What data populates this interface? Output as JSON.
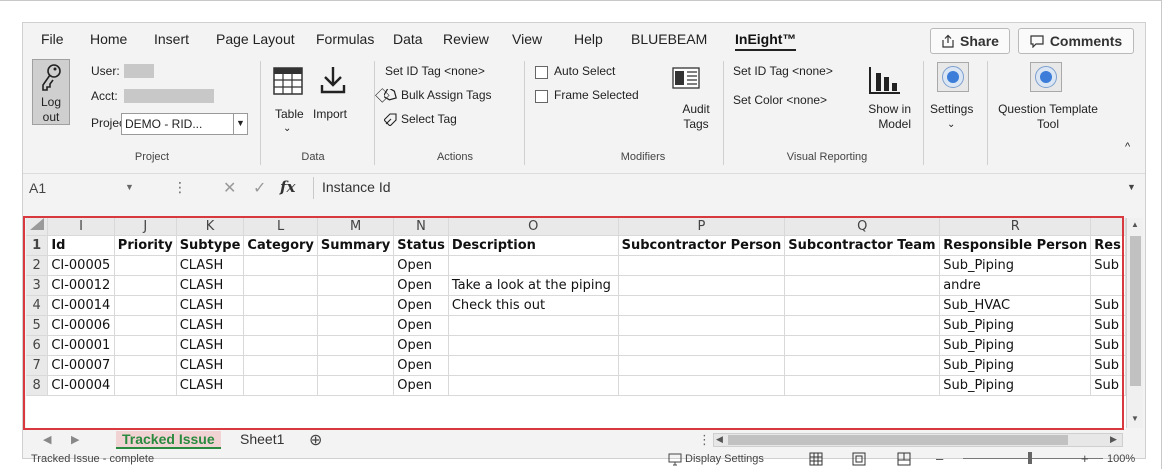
{
  "tabs": [
    "File",
    "Home",
    "Insert",
    "Page Layout",
    "Formulas",
    "Data",
    "Review",
    "View",
    "Help",
    "BLUEBEAM",
    "InEight™"
  ],
  "share_label": "Share",
  "comments_label": "Comments",
  "ribbon": {
    "project_group": {
      "logout_label": "Log out",
      "user_label": "User:",
      "acct_label": "Acct:",
      "project_label": "Project:",
      "project_value": "DEMO - RID...",
      "group_label": "Project"
    },
    "data_group": {
      "table_label": "Table",
      "import_label": "Import",
      "group_label": "Data"
    },
    "actions_group": {
      "set_id_tag": "Set ID Tag <none>",
      "bulk_assign": "Bulk Assign Tags",
      "select_tag": "Select Tag",
      "group_label": "Actions"
    },
    "modifiers_group": {
      "auto_select": "Auto Select",
      "frame_selected": "Frame Selected",
      "audit_tags": "Audit Tags",
      "group_label": "Modifiers"
    },
    "visual_group": {
      "set_id_tag": "Set ID Tag <none>",
      "set_color": "Set Color <none>",
      "show_in_model": "Show in Model",
      "group_label": "Visual Reporting"
    },
    "settings_label": "Settings",
    "question_template_label": "Question Template Tool"
  },
  "formula": {
    "cell_ref": "A1",
    "fx_label": "fx",
    "content": "Instance Id"
  },
  "grid": {
    "columns": [
      "I",
      "J",
      "K",
      "L",
      "M",
      "N",
      "O",
      "P",
      "Q",
      "R",
      ""
    ],
    "headers": [
      "Id",
      "Priority",
      "Subtype",
      "Category",
      "Summary",
      "Status",
      "Description",
      "Subcontractor Person",
      "Subcontractor Team",
      "Responsible Person",
      "Res"
    ],
    "rows": [
      {
        "num": "2",
        "cells": [
          "CI-00005",
          "",
          "CLASH",
          "",
          "",
          "Open",
          "",
          "",
          "",
          "Sub_Piping",
          "Sub"
        ]
      },
      {
        "num": "3",
        "cells": [
          "CI-00012",
          "",
          "CLASH",
          "",
          "",
          "Open",
          "Take a look at the piping",
          "",
          "",
          "andre",
          ""
        ]
      },
      {
        "num": "4",
        "cells": [
          "CI-00014",
          "",
          "CLASH",
          "",
          "",
          "Open",
          "Check this out",
          "",
          "",
          "Sub_HVAC",
          "Sub"
        ]
      },
      {
        "num": "5",
        "cells": [
          "CI-00006",
          "",
          "CLASH",
          "",
          "",
          "Open",
          "",
          "",
          "",
          "Sub_Piping",
          "Sub"
        ]
      },
      {
        "num": "6",
        "cells": [
          "CI-00001",
          "",
          "CLASH",
          "",
          "",
          "Open",
          "",
          "",
          "",
          "Sub_Piping",
          "Sub"
        ]
      },
      {
        "num": "7",
        "cells": [
          "CI-00007",
          "",
          "CLASH",
          "",
          "",
          "Open",
          "",
          "",
          "",
          "Sub_Piping",
          "Sub"
        ]
      },
      {
        "num": "8",
        "cells": [
          "CI-00004",
          "",
          "CLASH",
          "",
          "",
          "Open",
          "",
          "",
          "",
          "Sub_Piping",
          "Sub"
        ]
      }
    ]
  },
  "sheets": [
    "Tracked Issue",
    "Sheet1"
  ],
  "status": {
    "left_text": "Tracked Issue - complete",
    "display_settings": "Display Settings",
    "zoom": "100%"
  },
  "colors": {
    "highlight": "#d9383e",
    "active_sheet": "#2a8a3f"
  }
}
